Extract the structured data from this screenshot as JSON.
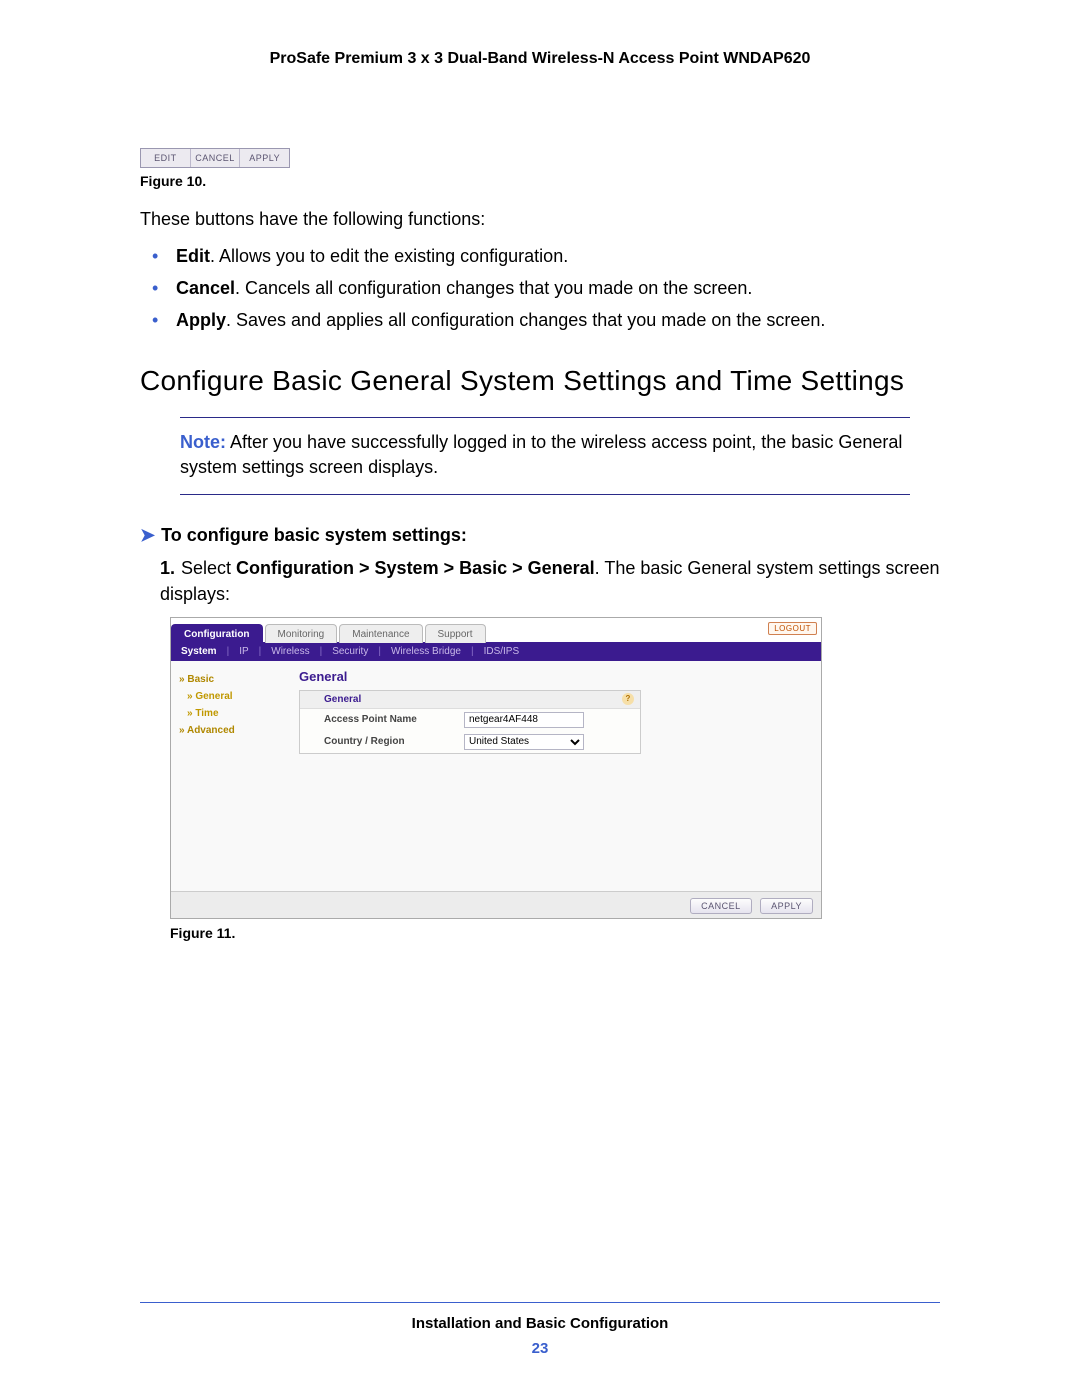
{
  "header": {
    "product_title": "ProSafe Premium 3 x 3 Dual-Band Wireless-N Access Point WNDAP620"
  },
  "figure10": {
    "buttons": [
      "EDIT",
      "CANCEL",
      "APPLY"
    ],
    "caption": "Figure 10."
  },
  "intro_paragraph": "These buttons have the following functions:",
  "bullets": [
    {
      "bold": "Edit",
      "text": ". Allows you to edit the existing configuration."
    },
    {
      "bold": "Cancel",
      "text": ". Cancels all configuration changes that you made on the screen."
    },
    {
      "bold": "Apply",
      "text": ". Saves and applies all configuration changes that you made on the screen."
    }
  ],
  "section_heading": "Configure Basic General System Settings and Time Settings",
  "note": {
    "label": "Note:",
    "text": "After you have successfully logged in to the wireless access point, the basic General system settings screen displays."
  },
  "procedure": {
    "title": "To configure basic system settings:",
    "step1_prefix": "1.",
    "step1_select_label": "Select ",
    "step1_path": "Configuration > System > Basic > General",
    "step1_tail": ". The basic General system settings screen displays:"
  },
  "ui": {
    "tabs": [
      "Configuration",
      "Monitoring",
      "Maintenance",
      "Support"
    ],
    "active_tab": "Configuration",
    "logout": "LOGOUT",
    "subnav": [
      "System",
      "IP",
      "Wireless",
      "Security",
      "Wireless Bridge",
      "IDS/IPS"
    ],
    "subnav_active": "System",
    "sidebar": {
      "group_basic": "Basic",
      "sub_general": "General",
      "sub_time": "Time",
      "group_advanced": "Advanced"
    },
    "main_title": "General",
    "box_title": "General",
    "rows": {
      "ap_name_label": "Access Point Name",
      "ap_name_value": "netgear4AF448",
      "country_label": "Country / Region",
      "country_value": "United States"
    },
    "footer_buttons": {
      "cancel": "CANCEL",
      "apply": "APPLY"
    }
  },
  "figure11_caption": "Figure 11.",
  "footer": {
    "title": "Installation and Basic Configuration",
    "page": "23"
  }
}
